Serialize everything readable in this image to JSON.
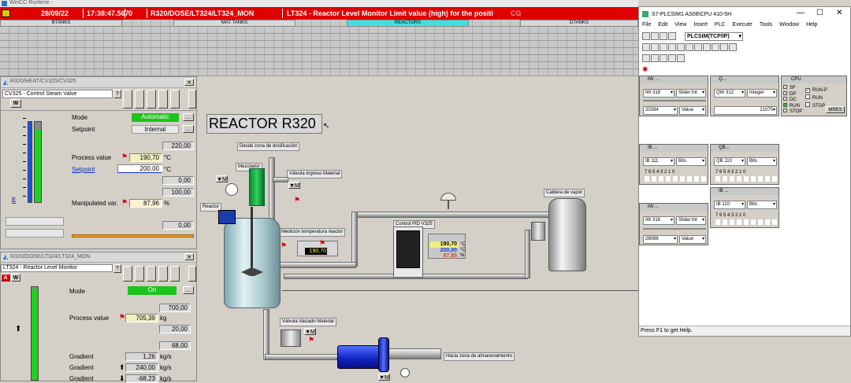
{
  "titlebar": {
    "title": "WinCC-Runtime - "
  },
  "alarm": {
    "date": "28/09/22",
    "time": "17:38:47.567",
    "num": "0",
    "tag": "R320/DOSE/LT324/LT324_MON",
    "text": "LT324 - Reactor Level Monitor Limit value (high) for the positi",
    "badge": "CG"
  },
  "nav": {
    "areas": [
      "BTANKS",
      "MAT TANKS",
      "REACTORS",
      "DTANKS"
    ]
  },
  "hmi": {
    "title": "REACTOR R320",
    "labels": {
      "dosing": "Desde zona de dosificación",
      "mixer": "Mezclador",
      "inlet_valve": "Válvula Ingreso Material",
      "temp": "Medición temperatura reactor",
      "pid": "Control PID V325",
      "boiler": "Caldera de vapor",
      "drain": "Válvula Vaciado Material",
      "storage": "Hacia zona de almacenamiento",
      "reactor": "Reactor"
    },
    "temp_value": "190,70",
    "pid_values": {
      "pv": "190,70",
      "sp": "200,00",
      "out": "87,85",
      "unit": "%",
      "c1": "°C",
      "c2": "°C"
    }
  },
  "faceplate1": {
    "title": "R320/HEAT/CV325/CV325",
    "subtitle": "CV325 - Control Steam Valve",
    "mode_label": "Mode",
    "mode_value": "Automatic",
    "setpoint_label": "Setpoint",
    "setpoint_value": "Internal",
    "hi": "220,00",
    "pv_label": "Process value",
    "pv": "190,70",
    "pv_unit": "°C",
    "sp_label": "Setpoint",
    "sp": "200,00",
    "sp_unit": "°C",
    "v1": "0,00",
    "v2": "100,00",
    "mv_label": "Manipulated var.",
    "mv": "87,96",
    "mv_unit": "%",
    "v3": "0,00",
    "e_label": "E"
  },
  "faceplate2": {
    "title": "R320/DOSE/LT324/LT324_MON",
    "subtitle": "LT324 - Reactor Level Monitor",
    "mode_label": "Mode",
    "mode_value": "On",
    "hi": "700,00",
    "pv_label": "Process value",
    "pv": "705,39",
    "pv_unit": "kg",
    "v1": "20,00",
    "v2": "68,00",
    "g1_label": "Gradient",
    "g1": "1,26",
    "g1_unit": "kg/s",
    "g2_label": "Gradient",
    "g2": "240,00",
    "g2_unit": "kg/s",
    "g3_label": "Gradient",
    "g3": "-68,23",
    "g3_unit": "kg/s"
  },
  "plcsim": {
    "title": "S7-PLCSIM1   AS08\\CPU 410-5H",
    "menu": [
      "File",
      "Edit",
      "View",
      "Insert",
      "PLC",
      "Execute",
      "Tools",
      "Window",
      "Help"
    ],
    "conn": "PLCSIM(TCP/IP)",
    "status": "Press F1 to get Help.",
    "iw318": {
      "addr": "IW  318",
      "fmt": "Slider:Int",
      "value": "20284",
      "mode": "Value"
    },
    "qw312": {
      "addr": "QW  312",
      "fmt": "Integer",
      "value": "21070"
    },
    "cpu": {
      "title": "CPU",
      "leds": [
        "SF",
        "DP",
        "DC",
        "RUN",
        "STOP"
      ],
      "opts": [
        "RUN-P",
        "RUN",
        "STOP"
      ],
      "mres": "MRES"
    },
    "ib111": {
      "addr": "IB   111",
      "fmt": "Bits",
      "bits": "7  6  5  4    3  2  1  0"
    },
    "qb110": {
      "addr": "QB   110",
      "fmt": "Bits",
      "bits": "7  6  5  4    3  2  1  0"
    },
    "ib110": {
      "addr": "IB   110",
      "fmt": "Bits",
      "bits": "7  6  5  4    3  2  1  0"
    },
    "iw316": {
      "addr": "IW  316",
      "fmt": "Slider:Int",
      "value": "28086",
      "mode": "Value"
    },
    "win_titles": {
      "a": "IW ...",
      "b": "Q...",
      "c": "CPU",
      "d": "IB ...",
      "e": "QB...",
      "f": "IB ...",
      "g": "IW ..."
    }
  },
  "colors": {
    "alarm_red": "#e00000",
    "bar_blue": "#2050e0",
    "bar_green": "#20d020",
    "mode_green": "#1cc41c"
  }
}
